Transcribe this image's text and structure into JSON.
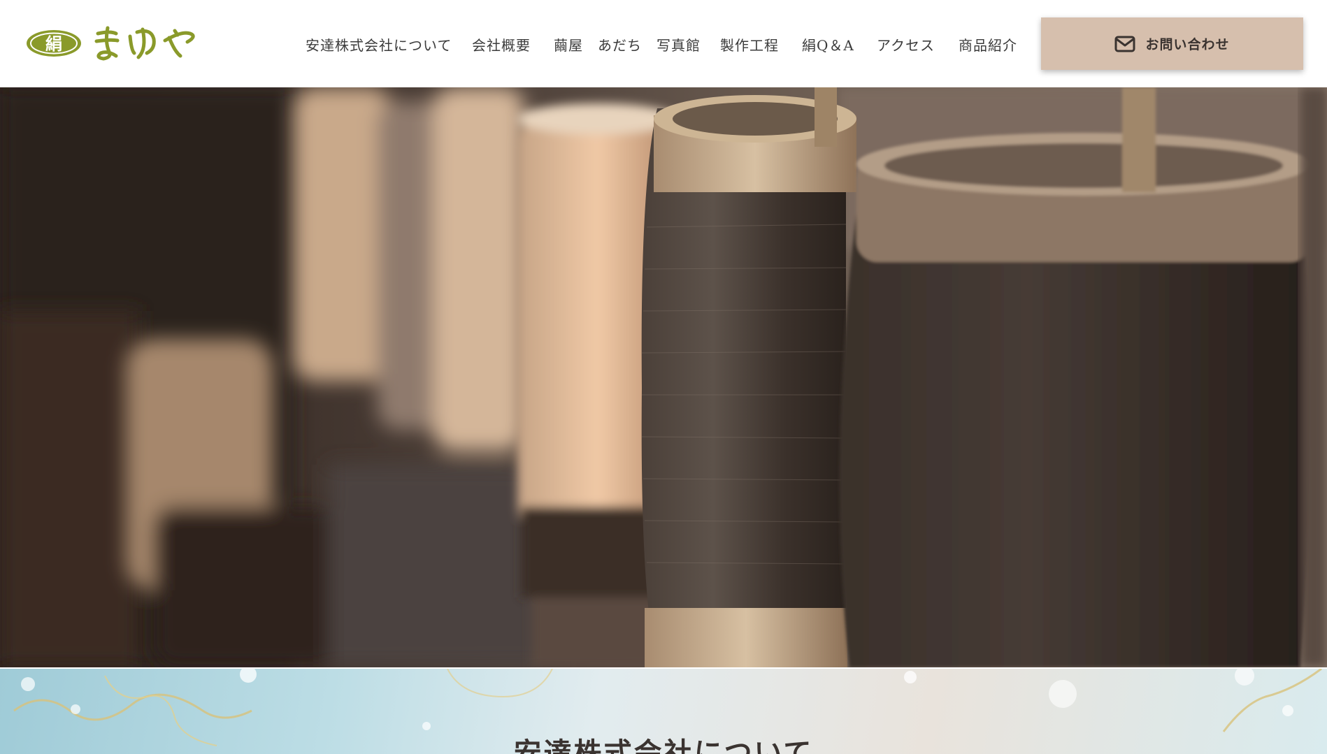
{
  "header": {
    "logo": {
      "mark_text": "絹",
      "name_text": "まゆや",
      "color": "#8a9a2a"
    },
    "nav": [
      {
        "label": "安達株式会社について"
      },
      {
        "label": "会社概要"
      },
      {
        "label": "繭屋　あだち　写真館"
      },
      {
        "label": "製作工程"
      },
      {
        "label": "絹Q＆A"
      },
      {
        "label": "アクセス"
      },
      {
        "label": "商品紹介"
      }
    ],
    "contact": {
      "label": "お問い合わせ",
      "icon": "envelope-icon",
      "bg_color": "#d6bfad"
    }
  },
  "hero": {
    "image": "silk-thread-spools-photo"
  },
  "section": {
    "title": "安達株式会社について"
  }
}
